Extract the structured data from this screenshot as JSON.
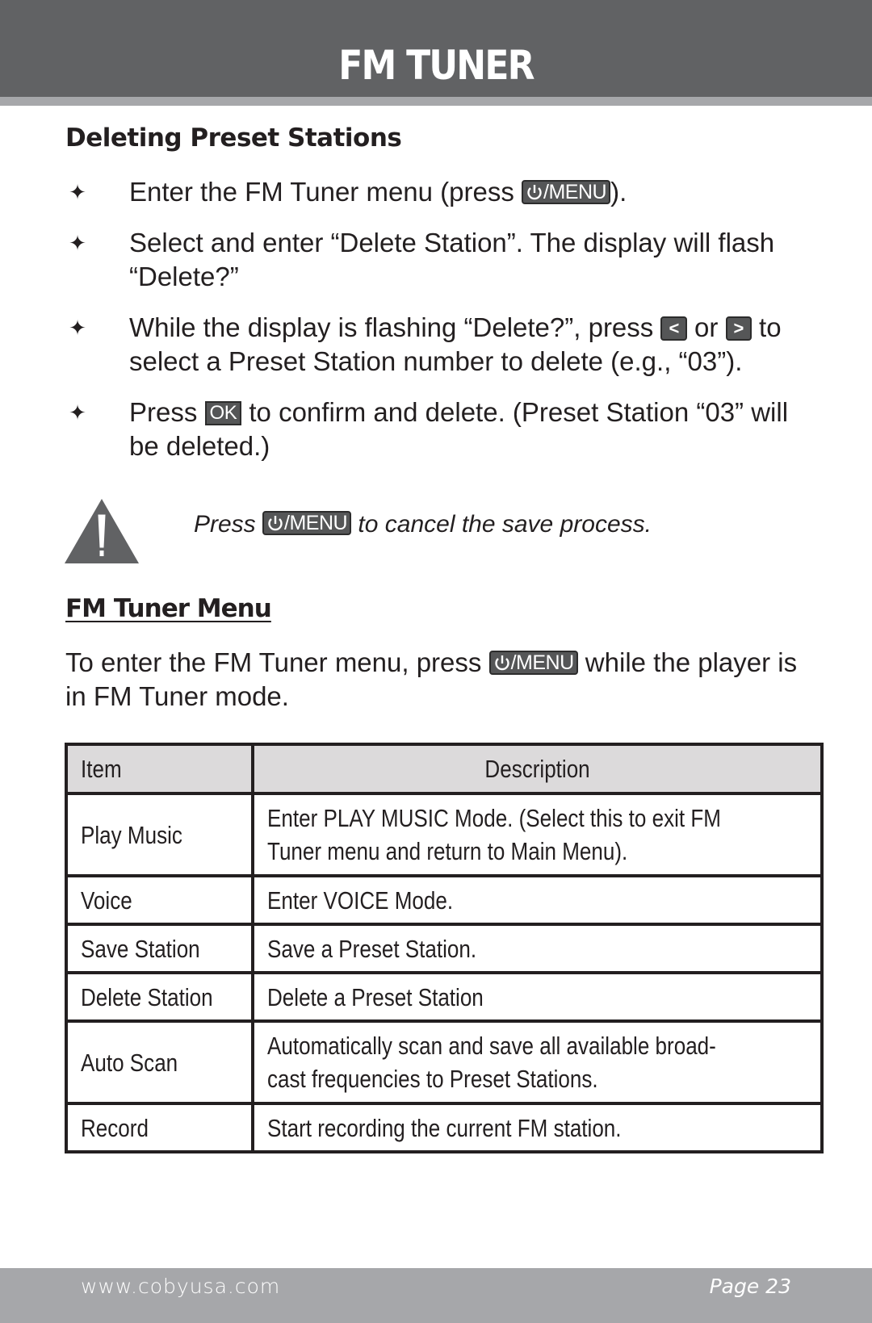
{
  "header": {
    "title": "FM TUNER"
  },
  "section_delete": {
    "heading": "Deleting Preset Stations",
    "bullets": [
      {
        "before": "Enter the FM Tuner menu (press ",
        "key": "/MENU",
        "after": ")."
      },
      {
        "text": "Select and enter “Delete Station”. The display will flash “Delete?”"
      },
      {
        "before": "While the display is flashing “Delete?”, press ",
        "key_left": "<",
        "middle": " or ",
        "key_right": ">",
        "after": " to select a Preset Station number to delete (e.g., “03”)."
      },
      {
        "before": "Press ",
        "key": "OK",
        "after": " to confirm and delete. (Preset Station “03” will be deleted.)"
      }
    ],
    "bullet_glyph": "✦"
  },
  "warning": {
    "icon": "warning-triangle-icon",
    "before": "Press ",
    "key": "/MENU",
    "after": " to cancel the save process."
  },
  "section_menu": {
    "heading": "FM Tuner Menu",
    "intro_before": "To enter the FM Tuner menu, press ",
    "intro_key": "/MENU",
    "intro_after": " while the player is in FM Tuner mode.",
    "table": {
      "headers": [
        "Item",
        "Description"
      ],
      "rows": [
        {
          "item": "Play Music",
          "desc_lines": [
            "Enter PLAY MUSIC Mode. (Select this to exit FM",
            "Tuner menu and return to Main Menu)."
          ]
        },
        {
          "item": "Voice",
          "desc_lines": [
            "Enter VOICE Mode."
          ]
        },
        {
          "item": "Save Station",
          "desc_lines": [
            "Save a Preset Station."
          ]
        },
        {
          "item": "Delete Station",
          "desc_lines": [
            "Delete a Preset Station"
          ]
        },
        {
          "item": "Auto Scan",
          "desc_lines": [
            "Automatically scan and save all available broad-",
            "cast frequencies to Preset Stations."
          ]
        },
        {
          "item": "Record",
          "desc_lines": [
            "Start recording the current FM station."
          ]
        }
      ]
    }
  },
  "footer": {
    "url": "www.cobyusa.com",
    "page": "Page 23"
  },
  "colors": {
    "header_bg": "#616264",
    "stripe": "#a6a7aa",
    "table_header_bg": "#dcdadb",
    "key_bg": "#555657"
  }
}
